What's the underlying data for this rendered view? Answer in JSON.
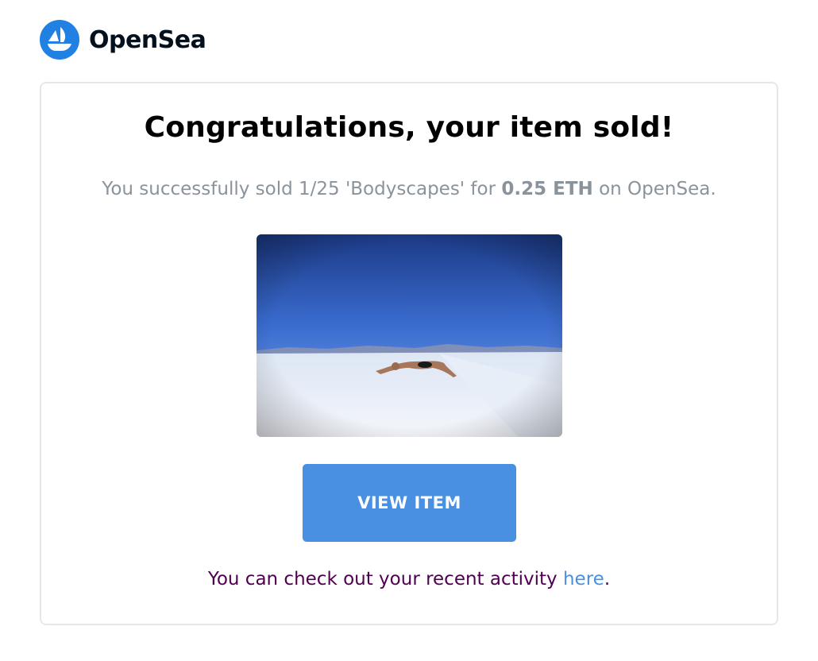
{
  "brand": {
    "name": "OpenSea",
    "logo_icon": "opensea-ship-icon",
    "logo_color": "#2081e2"
  },
  "email": {
    "title": "Congratulations, your item sold!",
    "subtitle_prefix": "You successfully sold 1/25 'Bodyscapes' for ",
    "price": "0.25 ETH",
    "subtitle_suffix": " on OpenSea.",
    "item_image_alt": "Bodyscapes",
    "button_label": "VIEW ITEM",
    "footer_prefix": "You can check out your recent activity ",
    "footer_link": "here",
    "footer_suffix": "."
  },
  "colors": {
    "button": "#4a90e2",
    "link": "#4a90e2",
    "footer_text": "#500050",
    "subtitle_text": "#8a939b"
  }
}
